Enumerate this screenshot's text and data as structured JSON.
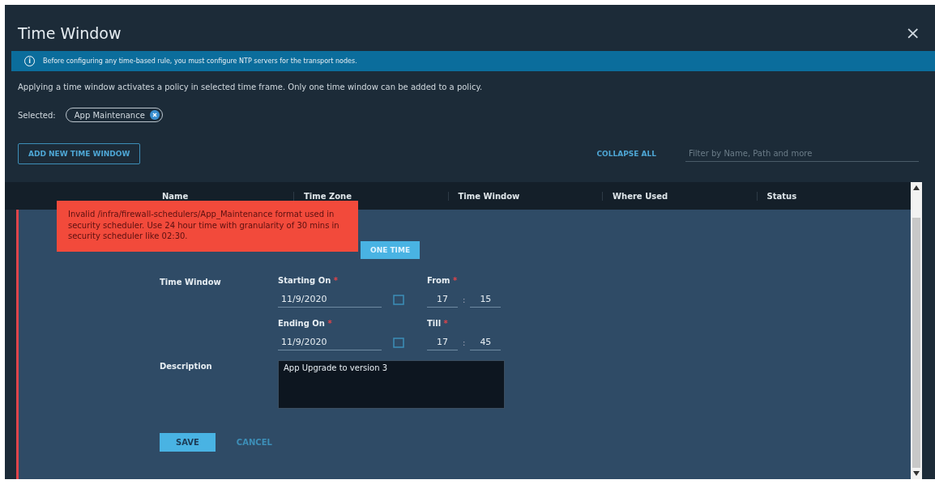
{
  "dialog": {
    "title": "Time Window",
    "close": "×"
  },
  "banner": {
    "icon": "i",
    "text": "Before configuring any time-based rule, you must configure NTP servers for the transport nodes."
  },
  "intro": "Applying a time window activates a policy in selected time frame. Only one time window can be added to a policy.",
  "selected": {
    "label": "Selected:",
    "chip": "App Maintenance"
  },
  "toolbar": {
    "add_button": "ADD NEW TIME WINDOW",
    "collapse": "COLLAPSE ALL",
    "search": {
      "placeholder": "Filter by Name, Path and more"
    }
  },
  "table": {
    "columns": [
      "Name",
      "Time Zone",
      "Time Window",
      "Where Used",
      "Status"
    ]
  },
  "editor": {
    "frequency_button": "ONE TIME",
    "section_label": "Time Window",
    "start": {
      "label": "Starting On",
      "date": "11/9/2020",
      "time_label": "From",
      "hour": "17",
      "minute": "15"
    },
    "end": {
      "label": "Ending On",
      "date": "11/9/2020",
      "time_label": "Till",
      "hour": "17",
      "minute": "45"
    },
    "required_mark": "*",
    "separator": ":",
    "description_label": "Description",
    "description": "App Upgrade to version 3",
    "save": "SAVE",
    "cancel": "CANCEL"
  },
  "error_toast": "Invalid /infra/firewall-schedulers/App_Maintenance format used in security scheduler. Use 24 hour time with granularity of 30 mins in security scheduler like 02:30."
}
